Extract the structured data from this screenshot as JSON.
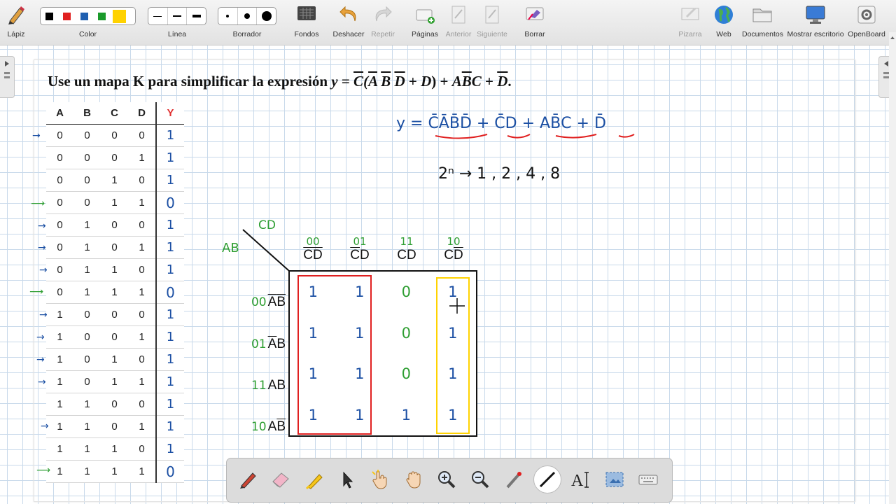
{
  "toolbar": {
    "pencil_label": "Lápiz",
    "color_label": "Color",
    "colors": [
      "#000000",
      "#e02020",
      "#1f5fb0",
      "#1a9a2a",
      "#ffd200"
    ],
    "line_label": "Línea",
    "eraser_label": "Borrador",
    "backgrounds_label": "Fondos",
    "undo_label": "Deshacer",
    "redo_label": "Repetir",
    "pages_label": "Páginas",
    "previous_label": "Anterior",
    "next_label": "Siguiente",
    "erase_label": "Borrar",
    "board_label": "Pizarra",
    "web_label": "Web",
    "documents_label": "Documentos",
    "desktop_label": "Mostrar escritorio",
    "openboard_label": "OpenBoard"
  },
  "content": {
    "title_text": "Use un mapa K para simplificar la expresión",
    "title_expr_y": "y",
    "title_expr_eq": " = ",
    "handwritten_expression": "y = C̄ĀB̄D̄ + C̄D + AB̄C + D̄",
    "powers_text": "2ⁿ → 1 , 2 , 4 , 8"
  },
  "truth_table": {
    "headers": [
      "A",
      "B",
      "C",
      "D",
      "Y"
    ],
    "rows": [
      [
        "0",
        "0",
        "0",
        "0",
        "1"
      ],
      [
        "0",
        "0",
        "0",
        "1",
        "1"
      ],
      [
        "0",
        "0",
        "1",
        "0",
        "1"
      ],
      [
        "0",
        "0",
        "1",
        "1",
        "0"
      ],
      [
        "0",
        "1",
        "0",
        "0",
        "1"
      ],
      [
        "0",
        "1",
        "0",
        "1",
        "1"
      ],
      [
        "0",
        "1",
        "1",
        "0",
        "1"
      ],
      [
        "0",
        "1",
        "1",
        "1",
        "0"
      ],
      [
        "1",
        "0",
        "0",
        "0",
        "1"
      ],
      [
        "1",
        "0",
        "0",
        "1",
        "1"
      ],
      [
        "1",
        "0",
        "1",
        "0",
        "1"
      ],
      [
        "1",
        "0",
        "1",
        "1",
        "1"
      ],
      [
        "1",
        "1",
        "0",
        "0",
        "1"
      ],
      [
        "1",
        "1",
        "0",
        "1",
        "1"
      ],
      [
        "1",
        "1",
        "1",
        "0",
        "1"
      ],
      [
        "1",
        "1",
        "1",
        "1",
        "0"
      ]
    ]
  },
  "kmap": {
    "cd_label": "CD",
    "ab_label": "AB",
    "col_codes": [
      "00",
      "01",
      "11",
      "10"
    ],
    "row_codes": [
      "00",
      "01",
      "11",
      "10"
    ],
    "cells": [
      [
        "1",
        "1",
        "0",
        "1"
      ],
      [
        "1",
        "1",
        "0",
        "1"
      ],
      [
        "1",
        "1",
        "0",
        "1"
      ],
      [
        "1",
        "1",
        "1",
        "1"
      ]
    ],
    "group_colors": [
      "#e02020",
      "#ffd200"
    ]
  }
}
